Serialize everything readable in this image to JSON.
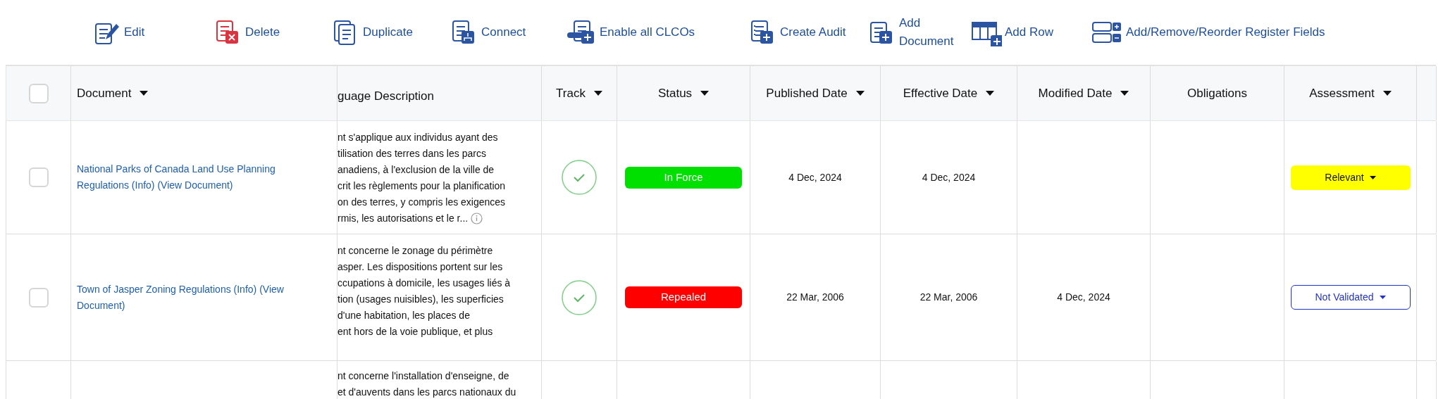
{
  "toolbar": [
    {
      "label": "Edit"
    },
    {
      "label": "Delete"
    },
    {
      "label": "Duplicate"
    },
    {
      "label": "Connect"
    },
    {
      "label": "Enable all CLCOs"
    },
    {
      "label": "Create Audit"
    },
    {
      "label": "Add Document"
    },
    {
      "label": "Add Row"
    },
    {
      "label": "Add/Remove/Reorder Register Fields"
    }
  ],
  "table": {
    "select_all": {
      "checked": false
    },
    "columns": [
      {
        "label": "Document",
        "sortable": true
      },
      {
        "label": "guage Description",
        "sortable": false
      },
      {
        "label": "Track",
        "sortable": true
      },
      {
        "label": "Status",
        "sortable": true
      },
      {
        "label": "Published Date",
        "sortable": true
      },
      {
        "label": "Effective Date",
        "sortable": true
      },
      {
        "label": "Modified Date",
        "sortable": true
      },
      {
        "label": "Obligations",
        "sortable": false
      },
      {
        "label": "Assessment",
        "sortable": true
      }
    ],
    "rows": [
      {
        "checked": false,
        "document": "National Parks of Canada Land Use Planning Regulations (Info) (View Document)",
        "description": [
          "nt s'applique aux individus ayant des",
          "tilisation des terres dans les parcs",
          "anadiens, à l'exclusion de la ville de",
          "crit les règlements pour la planification",
          "on des terres, y compris les exigences",
          "rmis, les autorisations et le r..."
        ],
        "info_icon": true,
        "tracked": true,
        "status": {
          "label": "In Force",
          "color": "#00e000"
        },
        "published": "4 Dec, 2024",
        "effective": "4 Dec, 2024",
        "assessment": {
          "label": "Relevant",
          "kind": "filled"
        }
      },
      {
        "checked": false,
        "document": "Town of Jasper Zoning Regulations (Info) (View Document)",
        "description": [
          "nt concerne le zonage du périmètre",
          "asper. Les dispositions portent sur les",
          "ccupations à domicile, les usages liés à",
          "tion (usages nuisibles), les superficies",
          "d'une habitation, les places de",
          "ent hors de la voie publique, et plus"
        ],
        "info_icon": false,
        "tracked": true,
        "status": {
          "label": "Repealed",
          "color": "#ff0000"
        },
        "published": "22 Mar, 2006",
        "effective": "22 Mar, 2006",
        "modified": "4 Dec, 2024",
        "assessment": {
          "label": "Not Validated",
          "kind": "outline"
        }
      },
      {
        "description": [
          "nt concerne l'installation d'enseigne, de",
          "et d'auvents dans les parcs nationaux du"
        ]
      }
    ]
  }
}
